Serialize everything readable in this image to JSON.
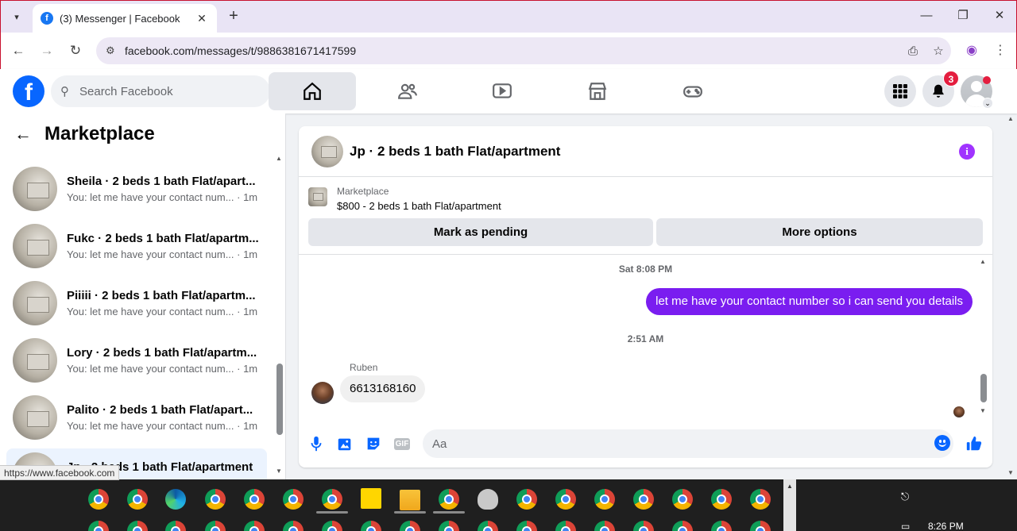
{
  "browser": {
    "tab_title": "(3) Messenger | Facebook",
    "url": "facebook.com/messages/t/9886381671417599",
    "status_url": "https://www.facebook.com"
  },
  "fb_header": {
    "search_placeholder": "Search Facebook",
    "notification_count": "3",
    "nav_icons": [
      "home-icon",
      "friends-icon",
      "video-icon",
      "marketplace-icon",
      "gaming-icon"
    ]
  },
  "sidebar": {
    "title": "Marketplace",
    "conversations": [
      {
        "name": "Sheila · 2 beds 1 bath Flat/apart...",
        "preview": "You: let me have your contact num... · 1m"
      },
      {
        "name": "Fukc · 2 beds 1 bath Flat/apartm...",
        "preview": "You: let me have your contact num... · 1m"
      },
      {
        "name": "Piiiii · 2 beds 1 bath Flat/apartm...",
        "preview": "You: let me have your contact num... · 1m"
      },
      {
        "name": "Lory · 2 beds 1 bath Flat/apartm...",
        "preview": "You: let me have your contact num... · 1m"
      },
      {
        "name": "Palito · 2 beds 1 bath Flat/apart...",
        "preview": "You: let me have your contact num... · 1m"
      },
      {
        "name": "Jp · 2 beds 1 bath Flat/apartment",
        "preview": ""
      }
    ]
  },
  "chat": {
    "title": "Jp · 2 beds 1 bath Flat/apartment",
    "marketplace_label": "Marketplace",
    "listing": "$800 - 2 beds 1 bath Flat/apartment",
    "mark_pending_label": "Mark as pending",
    "more_options_label": "More options",
    "timestamp_1": "Sat 8:08 PM",
    "outgoing_message": "let me have your contact number so i can send you details",
    "timestamp_2": "2:51 AM",
    "sender_name": "Ruben",
    "incoming_message": "6613168160",
    "input_placeholder": "Aa"
  },
  "taskbar": {
    "time": "8:26 PM"
  },
  "colors": {
    "fb_blue": "#0866ff",
    "outgoing_bubble": "#7a1df0",
    "badge_red": "#e41e3f"
  }
}
